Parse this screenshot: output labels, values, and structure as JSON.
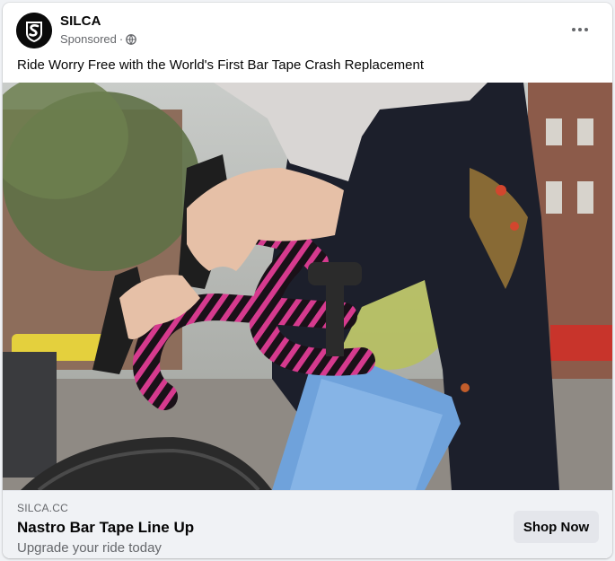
{
  "post": {
    "page_name": "SILCA",
    "sponsored_label": "Sponsored",
    "separator": "·",
    "audience_icon": "globe-icon",
    "more_icon": "more-horizontal-icon",
    "caption": "Ride Worry Free with the World's First Bar Tape Crash Replacement"
  },
  "media": {
    "description_icon": "ad-photo"
  },
  "link_preview": {
    "domain": "SILCA.CC",
    "headline": "Nastro Bar Tape Line Up",
    "description": "Upgrade your ride today",
    "cta_label": "Shop Now"
  },
  "colors": {
    "card_bg": "#ffffff",
    "footer_bg": "#f0f2f5",
    "secondary_text": "#65676b",
    "cta_bg": "#e4e6eb",
    "bar_tape_pink": "#d63a8e",
    "frame_blue": "#6fa2db"
  }
}
